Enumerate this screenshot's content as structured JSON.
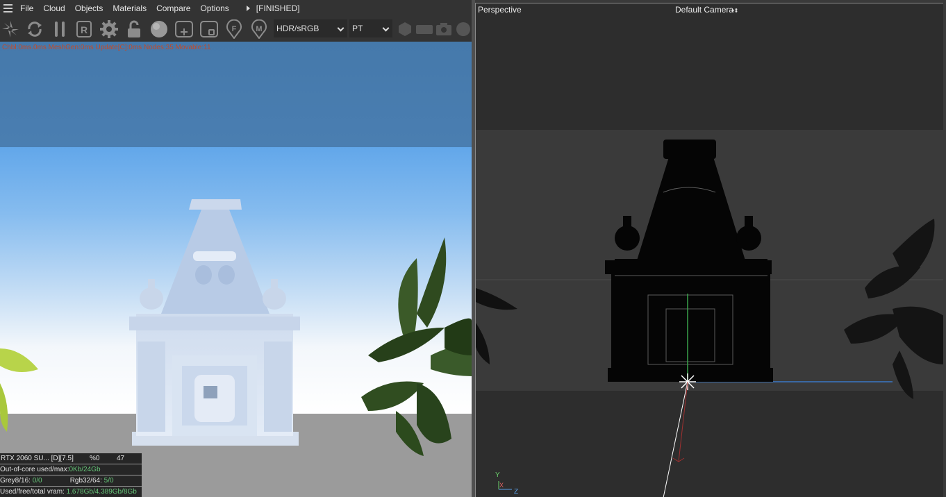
{
  "menu": {
    "items": [
      "File",
      "Cloud",
      "Objects",
      "Materials",
      "Compare",
      "Options"
    ],
    "status": "[FINISHED]"
  },
  "toolbar": {
    "icons": [
      "send-scene-icon",
      "restart-icon",
      "pause-icon",
      "region-render-icon",
      "settings-gear-icon",
      "lock-icon",
      "material-ball-icon",
      "add-region-icon",
      "clear-region-icon",
      "focus-picker-icon",
      "material-picker-icon"
    ],
    "tonemap_select": "HDR/sRGB",
    "kernel_select": "PT"
  },
  "render": {
    "stats": "Chbl:0ms.0ms  MeshGen:0ms  Update[C]:0ms  Nodes:35 Movable:11"
  },
  "gpu_info": {
    "device": "RTX 2060 SU... [D][7.5]",
    "percent": "%0",
    "temp": "47",
    "out_of_core_label": "Out-of-core used/max:",
    "out_of_core_value": "0Kb/24Gb",
    "grey_label": "Grey8/16:",
    "grey_value": "0/0",
    "rgb_label": "Rgb32/64:",
    "rgb_value": "5/0",
    "vram_label": "Used/free/total vram:",
    "vram_value": "1.678Gb/4.389Gb/8Gb"
  },
  "viewport": {
    "title": "Perspective",
    "camera": "Default Camera",
    "axis_y": "Y",
    "axis_x": "X",
    "axis_z": "Z"
  },
  "colors": {
    "accent_green": "#67c77a",
    "stats_red": "#c24a2a",
    "y_axis": "#6bd06b",
    "z_axis": "#5aa0e8"
  }
}
